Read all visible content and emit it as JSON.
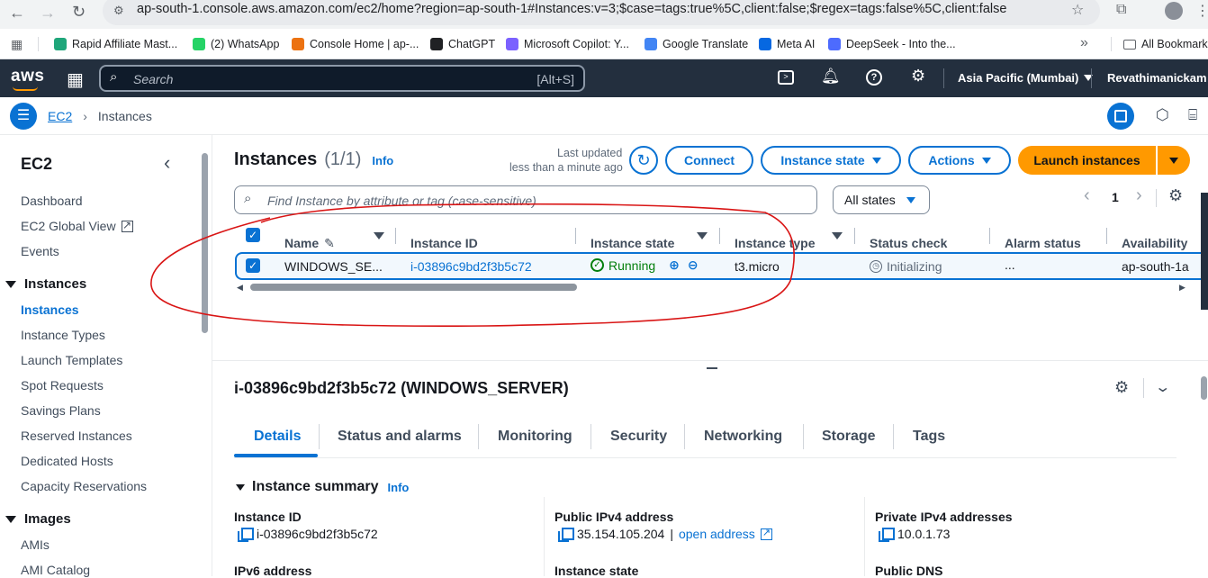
{
  "browser": {
    "url": "ap-south-1.console.aws.amazon.com/ec2/home?region=ap-south-1#Instances:v=3;$case=tags:true%5C,client:false;$regex=tags:false%5C,client:false",
    "bookmarks": [
      {
        "label": "Rapid Affiliate Mast...",
        "color": "#1fa67a"
      },
      {
        "label": "(2) WhatsApp",
        "color": "#25d366"
      },
      {
        "label": "Console Home | ap-...",
        "color": "#ec7211"
      },
      {
        "label": "ChatGPT",
        "color": "#202124"
      },
      {
        "label": "Microsoft Copilot: Y...",
        "color": "#7b61ff"
      },
      {
        "label": "Google Translate",
        "color": "#4285f4"
      },
      {
        "label": "Meta AI",
        "color": "#0668e1"
      },
      {
        "label": "DeepSeek - Into the...",
        "color": "#4d6bfe"
      }
    ],
    "more": "»",
    "all_bookmarks": "All Bookmarks"
  },
  "awsnav": {
    "logo": "aws",
    "search_placeholder": "Search",
    "search_shortcut": "[Alt+S]",
    "region": "Asia Pacific (Mumbai)",
    "user": "Revathimanickam"
  },
  "breadcrumb": {
    "service": "EC2",
    "page": "Instances"
  },
  "sidebar": {
    "title": "EC2",
    "items_top": [
      "Dashboard",
      "EC2 Global View",
      "Events"
    ],
    "section_instances": "Instances",
    "instances_items": [
      "Instances",
      "Instance Types",
      "Launch Templates",
      "Spot Requests",
      "Savings Plans",
      "Reserved Instances",
      "Dedicated Hosts",
      "Capacity Reservations"
    ],
    "section_images": "Images",
    "images_items": [
      "AMIs",
      "AMI Catalog"
    ]
  },
  "instances_panel": {
    "title": "Instances",
    "count": "(1/1)",
    "info": "Info",
    "last_updated_line1": "Last updated",
    "last_updated_line2": "less than a minute ago",
    "connect": "Connect",
    "instance_state": "Instance state",
    "actions": "Actions",
    "launch": "Launch instances",
    "filter_placeholder": "Find Instance by attribute or tag (case-sensitive)",
    "states_filter": "All states",
    "page": "1",
    "columns": [
      "Name",
      "Instance ID",
      "Instance state",
      "Instance type",
      "Status check",
      "Alarm status",
      "Availability"
    ],
    "rows": [
      {
        "name": "WINDOWS_SE...",
        "id": "i-03896c9bd2f3b5c72",
        "state": "Running",
        "type": "t3.micro",
        "status": "Initializing",
        "alarm": "...",
        "az": "ap-south-1a"
      }
    ]
  },
  "details": {
    "title": "i-03896c9bd2f3b5c72 (WINDOWS_SERVER)",
    "tabs": [
      "Details",
      "Status and alarms",
      "Monitoring",
      "Security",
      "Networking",
      "Storage",
      "Tags"
    ],
    "summary_title": "Instance summary",
    "summary_info": "Info",
    "instance_id_label": "Instance ID",
    "instance_id": "i-03896c9bd2f3b5c72",
    "public_ipv4_label": "Public IPv4 address",
    "public_ipv4": "35.154.105.204",
    "open_address": "open address",
    "private_ipv4_label": "Private IPv4 addresses",
    "private_ipv4": "10.0.1.73",
    "ipv6_label": "IPv6 address",
    "instance_state_label": "Instance state",
    "public_dns_label": "Public DNS"
  },
  "colors": {
    "aws_nav": "#232f3e",
    "link": "#0972d3",
    "launch": "#ff9900",
    "running": "#037f0c",
    "annotation": "#d91515"
  }
}
